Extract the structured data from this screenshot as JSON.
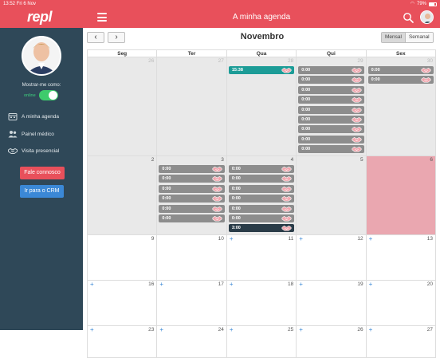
{
  "status_bar": {
    "time": "13:52",
    "date": "Fri 6 Nov",
    "battery": "79%"
  },
  "header": {
    "logo": "repl",
    "title": "A minha agenda"
  },
  "sidebar": {
    "show_as_label": "Mostrar-me como:",
    "status_label": "online",
    "nav": [
      {
        "label": "A minha agenda",
        "icon": "calendar-icon"
      },
      {
        "label": "Painel médico",
        "icon": "users-icon"
      },
      {
        "label": "Visita presencial",
        "icon": "handshake-icon"
      }
    ],
    "contact_button": "Fale connosco",
    "crm_button": "Ir para o CRM"
  },
  "calendar": {
    "month": "Novembro",
    "prev": "‹",
    "next": "›",
    "views": [
      "Mensal",
      "Semanal"
    ],
    "active_view": "Mensal",
    "weekdays": [
      "Seg",
      "Ter",
      "Qua",
      "Qui",
      "Sex"
    ],
    "add_symbol": "+",
    "weeks": [
      [
        {
          "day": "26",
          "state": "past-other",
          "events": []
        },
        {
          "day": "27",
          "state": "past-other",
          "events": []
        },
        {
          "day": "28",
          "state": "past-other",
          "events": [
            {
              "time": "15:38",
              "style": "teal"
            }
          ]
        },
        {
          "day": "29",
          "state": "past-other",
          "events": [
            {
              "time": "0:00",
              "style": "grey"
            },
            {
              "time": "0:00",
              "style": "grey"
            },
            {
              "time": "0:00",
              "style": "grey"
            },
            {
              "time": "0:00",
              "style": "grey"
            },
            {
              "time": "0:00",
              "style": "grey"
            },
            {
              "time": "0:00",
              "style": "grey"
            },
            {
              "time": "0:00",
              "style": "grey"
            },
            {
              "time": "0:00",
              "style": "grey"
            },
            {
              "time": "0:00",
              "style": "grey"
            }
          ]
        },
        {
          "day": "30",
          "state": "past-other",
          "events": [
            {
              "time": "0:00",
              "style": "grey"
            },
            {
              "time": "0:00",
              "style": "grey"
            }
          ]
        }
      ],
      [
        {
          "day": "2",
          "state": "past",
          "events": []
        },
        {
          "day": "3",
          "state": "past",
          "events": [
            {
              "time": "0:00",
              "style": "grey"
            },
            {
              "time": "0:00",
              "style": "grey"
            },
            {
              "time": "0:00",
              "style": "grey"
            },
            {
              "time": "0:00",
              "style": "grey"
            },
            {
              "time": "0:00",
              "style": "grey"
            },
            {
              "time": "0:00",
              "style": "grey"
            }
          ]
        },
        {
          "day": "4",
          "state": "past",
          "events": [
            {
              "time": "0:00",
              "style": "grey"
            },
            {
              "time": "0:00",
              "style": "grey"
            },
            {
              "time": "0:00",
              "style": "grey"
            },
            {
              "time": "0:00",
              "style": "grey"
            },
            {
              "time": "0:00",
              "style": "grey"
            },
            {
              "time": "0:00",
              "style": "grey"
            },
            {
              "time": "3:00",
              "style": "dark"
            }
          ]
        },
        {
          "day": "5",
          "state": "past",
          "events": []
        },
        {
          "day": "6",
          "state": "today",
          "events": []
        }
      ],
      [
        {
          "day": "9",
          "state": "future",
          "plus": false,
          "events": []
        },
        {
          "day": "10",
          "state": "future",
          "plus": false,
          "events": []
        },
        {
          "day": "11",
          "state": "future",
          "plus": true,
          "events": []
        },
        {
          "day": "12",
          "state": "future",
          "plus": true,
          "events": []
        },
        {
          "day": "13",
          "state": "future",
          "plus": true,
          "events": []
        }
      ],
      [
        {
          "day": "16",
          "state": "future",
          "plus": true,
          "events": []
        },
        {
          "day": "17",
          "state": "future",
          "plus": true,
          "events": []
        },
        {
          "day": "18",
          "state": "future",
          "plus": true,
          "events": []
        },
        {
          "day": "19",
          "state": "future",
          "plus": true,
          "events": []
        },
        {
          "day": "20",
          "state": "future",
          "plus": true,
          "events": []
        }
      ],
      [
        {
          "day": "23",
          "state": "future",
          "plus": true,
          "events": []
        },
        {
          "day": "24",
          "state": "future",
          "plus": true,
          "events": []
        },
        {
          "day": "25",
          "state": "future",
          "plus": true,
          "events": []
        },
        {
          "day": "26",
          "state": "future",
          "plus": true,
          "events": []
        },
        {
          "day": "27",
          "state": "future",
          "plus": true,
          "events": []
        }
      ]
    ]
  },
  "colors": {
    "brand": "#e8505b",
    "sidebar": "#2f4858",
    "teal_event": "#1c9c97",
    "grey_event": "#8d8d8d",
    "dark_event": "#2a3c48",
    "today": "#eaa7b0",
    "online": "#3ecb6c",
    "crm_button": "#3b88d6"
  }
}
